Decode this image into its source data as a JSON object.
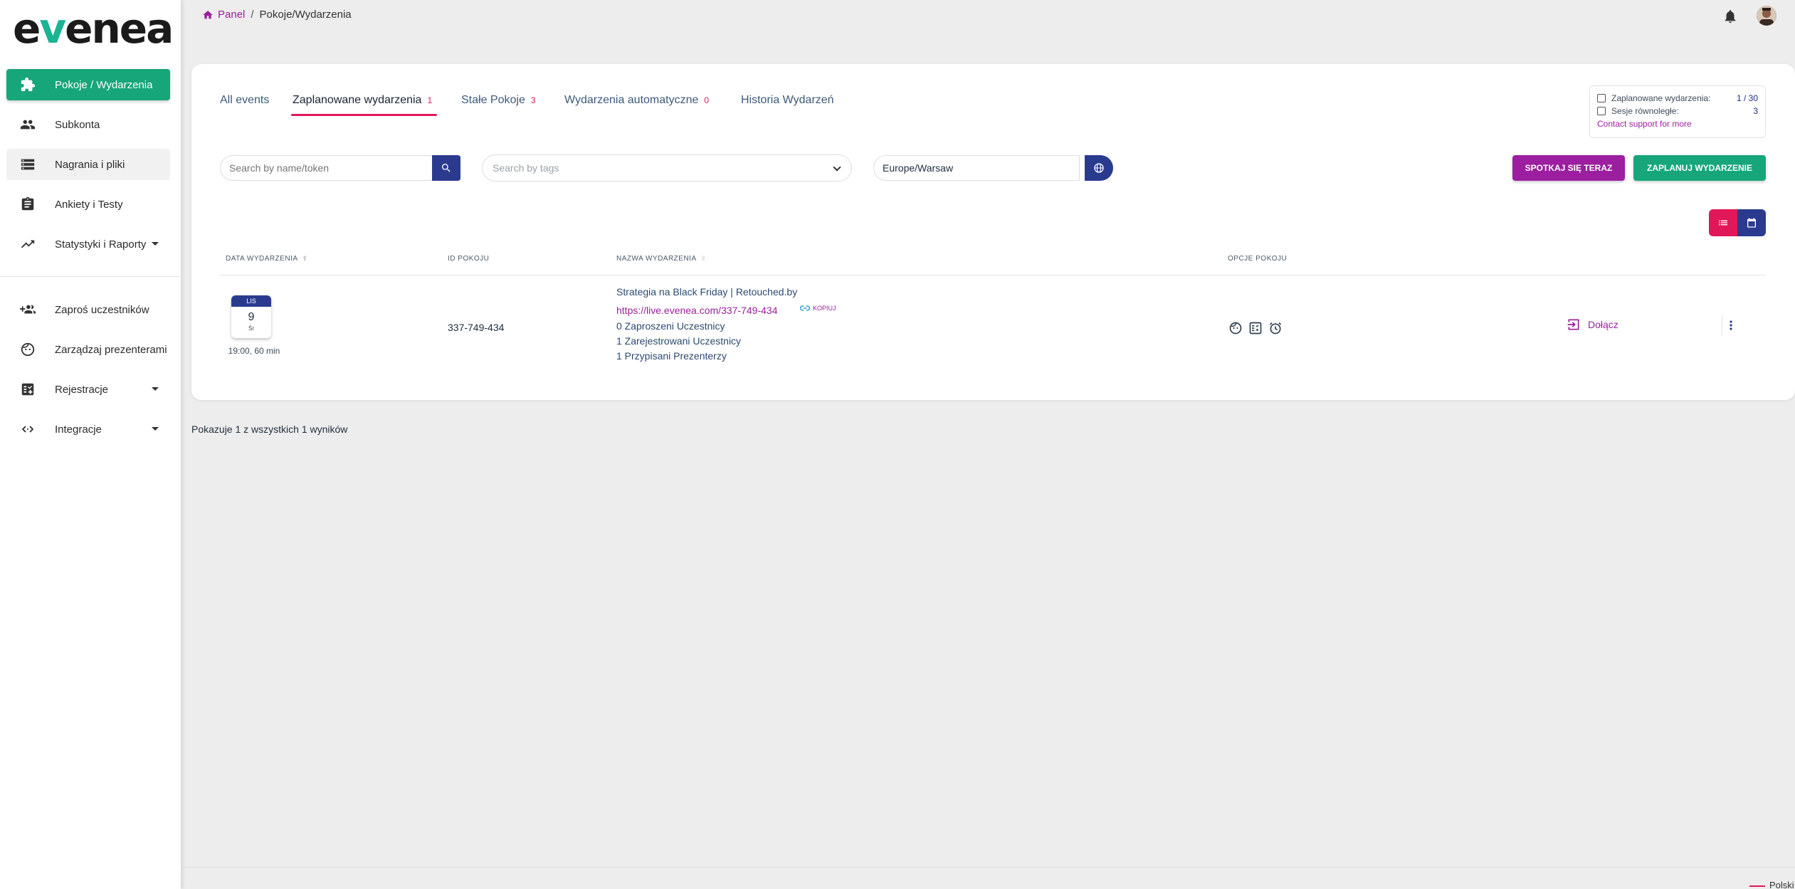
{
  "app": {
    "logo_prefix": "e",
    "logo_v": "v",
    "logo_suffix": "enea"
  },
  "breadcrumb": {
    "home": "Panel",
    "separator": "/",
    "current": "Pokoje/Wydarzenia"
  },
  "sidebar": {
    "items": [
      {
        "label": "Pokoje / Wydarzenia",
        "icon": "puzzle-icon"
      },
      {
        "label": "Subkonta",
        "icon": "people-icon"
      },
      {
        "label": "Nagrania i pliki",
        "icon": "storage-icon"
      },
      {
        "label": "Ankiety i Testy",
        "icon": "clipboard-icon"
      },
      {
        "label": "Statystyki i Raporty",
        "icon": "trending-icon"
      },
      {
        "label": "Zaproś uczestników",
        "icon": "add-group-icon"
      },
      {
        "label": "Zarządzaj prezenterami",
        "icon": "face-icon"
      },
      {
        "label": "Rejestracje",
        "icon": "form-icon"
      },
      {
        "label": "Integracje",
        "icon": "code-arrows-icon"
      }
    ]
  },
  "tabs": [
    {
      "label": "All events",
      "count": ""
    },
    {
      "label": "Zaplanowane wydarzenia",
      "count": "1"
    },
    {
      "label": "Stałe Pokoje",
      "count": "3"
    },
    {
      "label": "Wydarzenia automatyczne",
      "count": "0"
    },
    {
      "label": "Historia Wydarzeń",
      "count": ""
    }
  ],
  "quota": {
    "scheduled_label": "Zaplanowane wydarzenia:",
    "scheduled_value": "1 / 30",
    "parallel_label": "Sesje równoległe:",
    "parallel_value": "3",
    "support_link": "Contact support for more"
  },
  "search": {
    "placeholder": "Search by name/token"
  },
  "tags": {
    "placeholder": "Search by tags"
  },
  "timezone": {
    "value": "Europe/Warsaw"
  },
  "buttons": {
    "meet_now": "SPOTKAJ SIĘ TERAZ",
    "schedule": "ZAPLANUJ WYDARZENIE"
  },
  "table": {
    "headers": [
      "DATA WYDARZENIA",
      "ID POKOJU",
      "NAZWA WYDARZENIA",
      "OPCJE POKOJU"
    ],
    "rows": [
      {
        "month": "LIS",
        "day": "9",
        "weekday": "Śr",
        "time": "19:00, 60 min",
        "room_id": "337-749-434",
        "name": "Strategia na Black Friday | Retouched.by",
        "link": "https://live.evenea.com/337-749-434",
        "copy_label": "KOPIUJ",
        "invited": "0 Zaproszeni Uczestnicy",
        "registered": "1 Zarejestrowani Uczestnicy",
        "presenters": "1 Przypisani Prezenterzy",
        "join_label": "Dołącz"
      }
    ]
  },
  "results_text": "Pokazuje 1 z wszystkich 1 wyników",
  "language": "Polski",
  "colors": {
    "green": "#17a679",
    "purple": "#9b1f9e",
    "pink": "#e0185a",
    "navy": "#2a3b8f"
  }
}
